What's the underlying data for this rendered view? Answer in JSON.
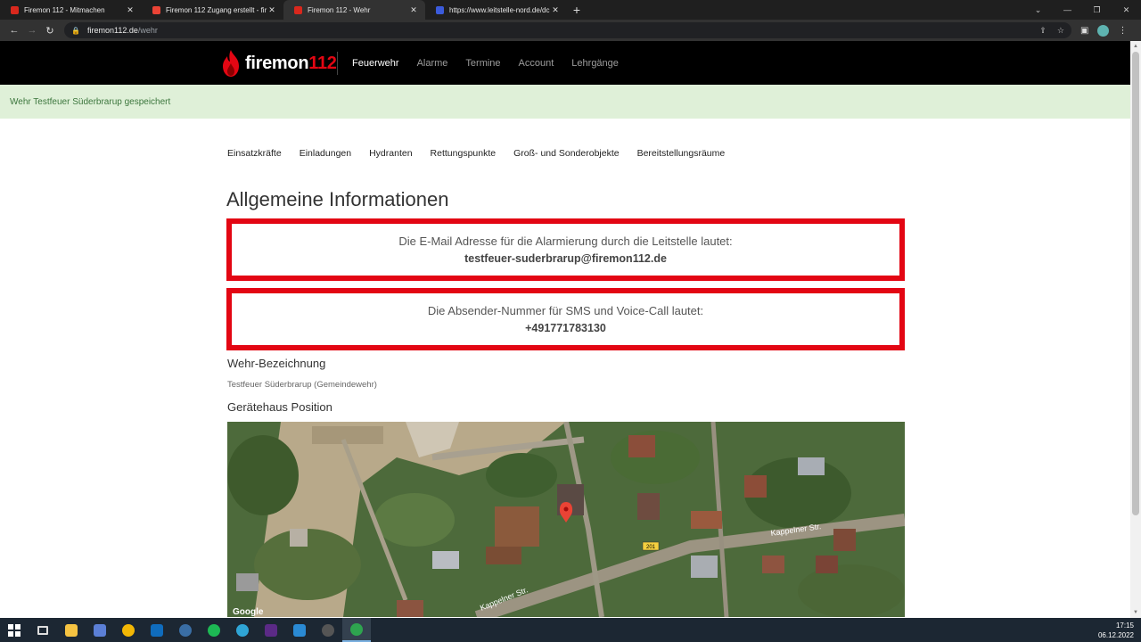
{
  "browser": {
    "tabs": [
      {
        "title": "Firemon 112 - Mitmachen",
        "favicon_color": "#d9281d",
        "active": false
      },
      {
        "title": "Firemon 112 Zugang erstellt - fir",
        "favicon_color": "#ea4335",
        "active": false
      },
      {
        "title": "Firemon 112 - Wehr",
        "favicon_color": "#d9281d",
        "active": true
      },
      {
        "title": "https://www.leitstelle-nord.de/dc",
        "favicon_color": "#3b5bdb",
        "active": false
      }
    ],
    "new_tab": "+",
    "url_host": "firemon112.de",
    "url_path": "/wehr"
  },
  "site": {
    "brand_word": "firemon",
    "brand_number": "112",
    "nav": [
      {
        "label": "Feuerwehr",
        "active": true
      },
      {
        "label": "Alarme",
        "active": false
      },
      {
        "label": "Termine",
        "active": false
      },
      {
        "label": "Account",
        "active": false
      },
      {
        "label": "Lehrgänge",
        "active": false
      }
    ]
  },
  "alert": {
    "text": "Wehr Testfeuer Süderbrarup gespeichert"
  },
  "subnav": [
    "Einsatzkräfte",
    "Einladungen",
    "Hydranten",
    "Rettungspunkte",
    "Groß- und Sonderobjekte",
    "Bereitstellungsräume"
  ],
  "page": {
    "title": "Allgemeine Informationen",
    "email_box": {
      "label": "Die E-Mail Adresse für die Alarmierung durch die Leitstelle lautet:",
      "value": "testfeuer-suderbrarup@firemon112.de"
    },
    "sms_box": {
      "label": "Die Absender-Nummer für SMS und Voice-Call lautet:",
      "value": "+491771783130"
    },
    "wehr_heading": "Wehr-Bezeichnung",
    "wehr_value": "Testfeuer Süderbrarup (Gemeindewehr)",
    "position_heading": "Gerätehaus Position",
    "map": {
      "street_label_1": "Kappelner Str.",
      "street_label_2": "Kappelner Str.",
      "road_number": "201",
      "provider": "Google"
    }
  },
  "taskbar": {
    "time": "17:15",
    "date": "06.12.2022"
  }
}
